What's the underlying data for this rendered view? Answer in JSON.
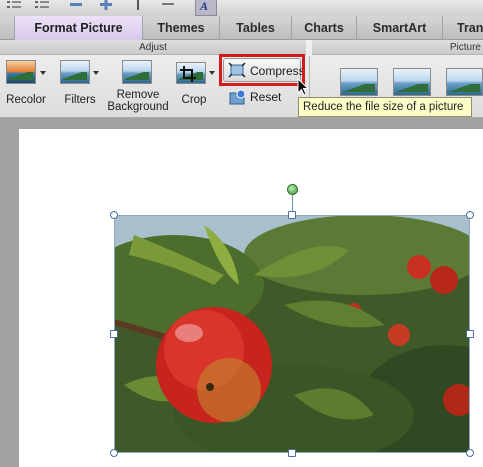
{
  "tabs": [
    {
      "label": "Format Picture",
      "active": true
    },
    {
      "label": "Themes",
      "active": false
    },
    {
      "label": "Tables",
      "active": false
    },
    {
      "label": "Charts",
      "active": false
    },
    {
      "label": "SmartArt",
      "active": false
    },
    {
      "label": "Tran",
      "active": false
    }
  ],
  "groups": {
    "adjust": "Adjust",
    "picture_styles": "Picture"
  },
  "buttons": {
    "recolor": "Recolor",
    "filters": "Filters",
    "remove_background_1": "Remove",
    "remove_background_2": "Background",
    "crop": "Crop",
    "compress": "Compress",
    "reset": "Reset"
  },
  "tooltip": "Reduce the file size of a picture",
  "toolbar_active_glyph": "A",
  "colors": {
    "highlight": "#d31b1b",
    "tooltip_bg": "#fdfdc8",
    "active_tab": "#ddd0ef"
  }
}
